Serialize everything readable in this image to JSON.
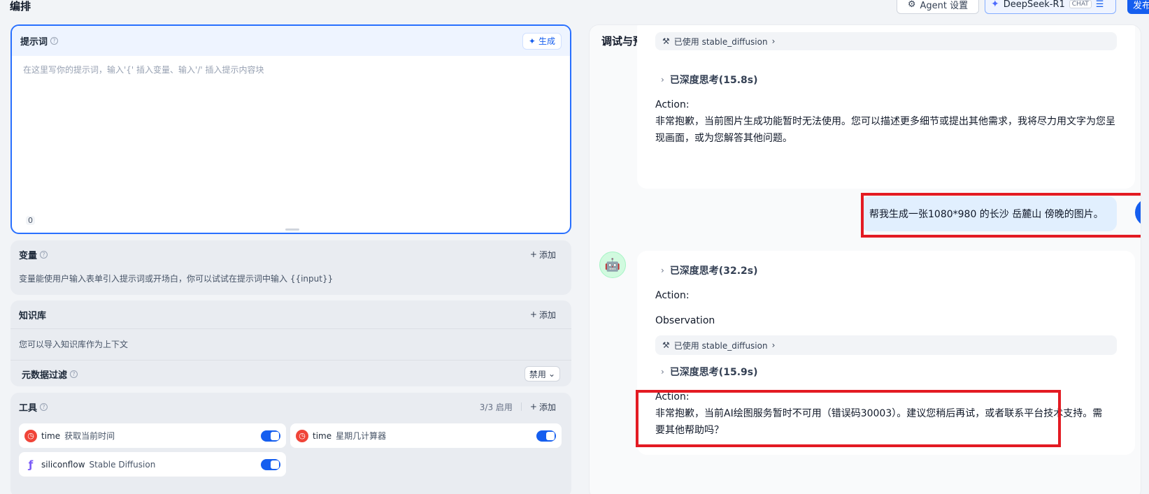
{
  "header": {
    "title": "编排",
    "agent_settings": "Agent 设置",
    "model_name": "DeepSeek-R1",
    "model_badge": "CHAT",
    "publish": "发布"
  },
  "prompt": {
    "title": "提示词",
    "generate": "生成",
    "placeholder": "在这里写你的提示词，输入'{' 插入变量、输入'/' 插入提示内容块",
    "count": "0"
  },
  "variables": {
    "title": "变量",
    "add": "添加",
    "desc": "变量能使用户输入表单引入提示词或开场白，你可以试试在提示词中输入 {{input}}"
  },
  "knowledge": {
    "title": "知识库",
    "add": "添加",
    "desc": "您可以导入知识库作为上下文",
    "metadata_filter": "元数据过滤",
    "metadata_value": "禁用"
  },
  "tools": {
    "title": "工具",
    "enabled": "3/3 启用",
    "add": "添加",
    "items": [
      {
        "name": "time",
        "desc": "获取当前时间"
      },
      {
        "name": "time",
        "desc": "星期几计算器"
      },
      {
        "name": "siliconflow",
        "desc": "Stable Diffusion"
      }
    ]
  },
  "debug": {
    "title": "调试与预览",
    "msg1": {
      "tool_used_top": "已使用 stable_diffusion",
      "think": "已深度思考(15.8s)",
      "action_label": "Action:",
      "text": "非常抱歉，当前图片生成功能暂时无法使用。您可以描述更多细节或提出其他需求，我将尽力用文字为您呈现画面，或为您解答其他问题。"
    },
    "user_msg": "帮我生成一张1080*980 的长沙 岳麓山 傍晚的图片。",
    "msg2": {
      "think1": "已深度思考(32.2s)",
      "action_label": "Action:",
      "observation": "Observation",
      "tool_used": "已使用 stable_diffusion",
      "think2": "已深度思考(15.9s)",
      "action_label2": "Action:",
      "text": "非常抱歉，当前AI绘图服务暂时不可用（错误码30003）。建议您稍后再试，或者联系平台技术支持。需要其他帮助吗？"
    }
  },
  "colors": {
    "accent": "#155eef",
    "highlight": "#e31b23"
  }
}
